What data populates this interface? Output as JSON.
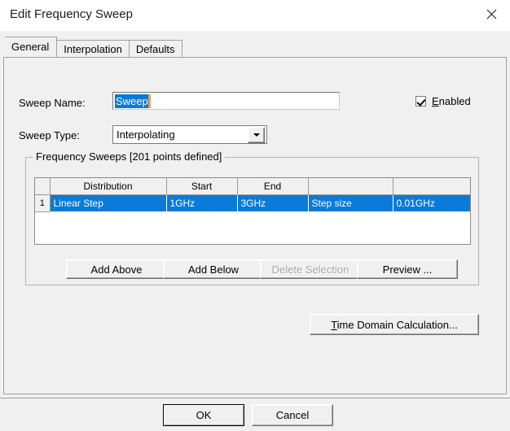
{
  "window": {
    "title": "Edit Frequency Sweep",
    "close_icon": "close-icon"
  },
  "tabs": [
    {
      "label": "General",
      "active": true
    },
    {
      "label": "Interpolation",
      "active": false
    },
    {
      "label": "Defaults",
      "active": false
    }
  ],
  "general": {
    "sweep_name": {
      "label": "Sweep Name:",
      "value": "Sweep",
      "selected": true
    },
    "enabled": {
      "label_accel": "E",
      "label_rest": "nabled",
      "checked": true
    },
    "sweep_type": {
      "label": "Sweep Type:",
      "value": "Interpolating",
      "arrow_icon": "chevron-down-icon"
    },
    "frequency_sweeps": {
      "group_title": "Frequency Sweeps [201 points defined]",
      "columns": [
        "",
        "Distribution",
        "Start",
        "End",
        "",
        ""
      ],
      "rows": [
        {
          "index": "1",
          "distribution": "Linear Step",
          "start": "1GHz",
          "end": "3GHz",
          "type": "Step size",
          "value": "0.01GHz",
          "selected": true
        }
      ],
      "buttons": {
        "add_above": "Add Above",
        "add_below": "Add Below",
        "delete_selection": "Delete Selection",
        "delete_selection_enabled": false,
        "preview": "Preview ..."
      }
    },
    "time_domain": {
      "accel": "T",
      "rest": "ime Domain Calculation..."
    }
  },
  "footer": {
    "ok": "OK",
    "cancel": "Cancel"
  },
  "colors": {
    "selection_blue": "#0b7ad8",
    "dialog_bg": "#f0f0f0",
    "caret": "#e8a15e"
  }
}
